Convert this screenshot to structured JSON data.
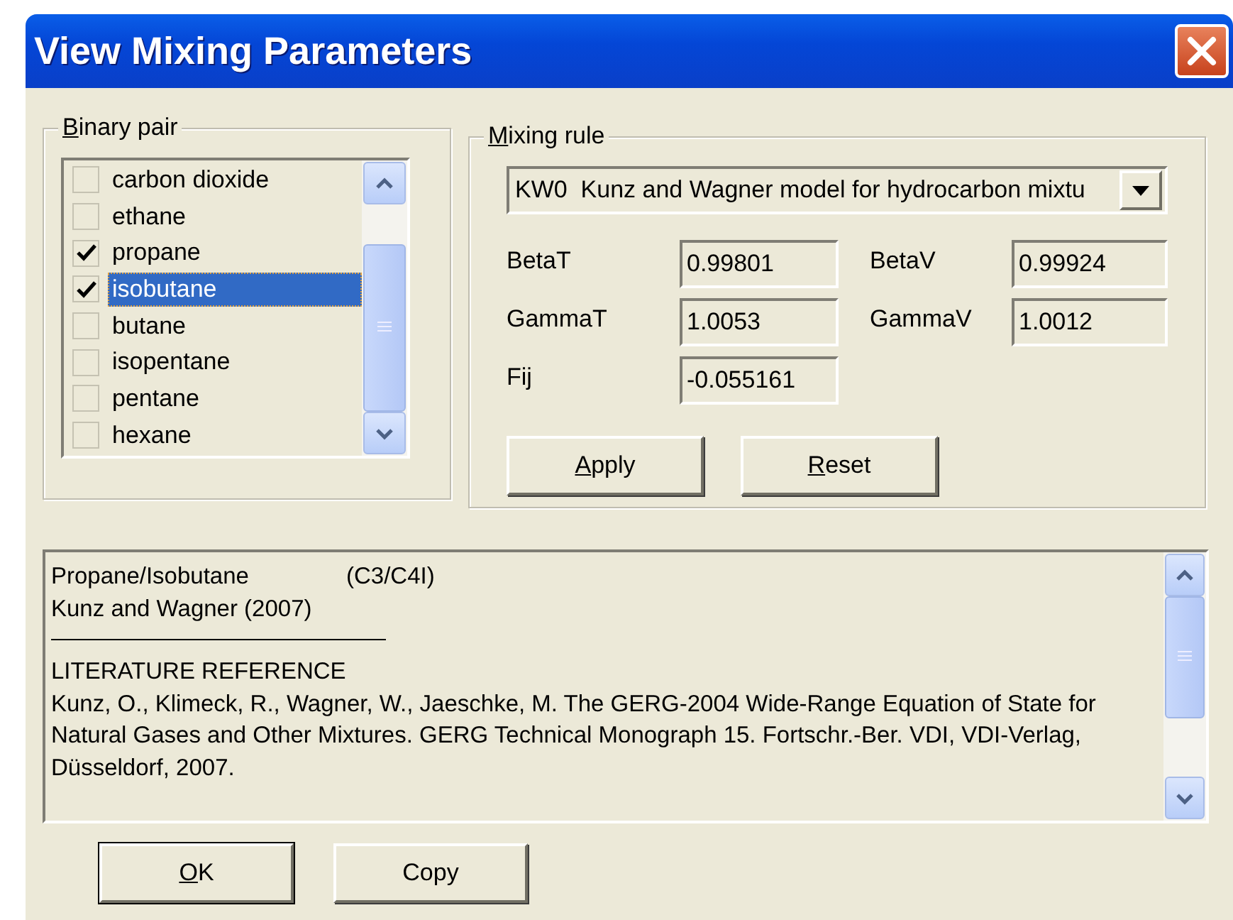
{
  "window": {
    "title": "View Mixing Parameters"
  },
  "binary_pair": {
    "label": "Binary pair",
    "underline_first": true,
    "items": [
      {
        "label": "carbon dioxide",
        "checked": false,
        "selected": false
      },
      {
        "label": "ethane",
        "checked": false,
        "selected": false
      },
      {
        "label": "propane",
        "checked": true,
        "selected": false
      },
      {
        "label": "isobutane",
        "checked": true,
        "selected": true
      },
      {
        "label": "butane",
        "checked": false,
        "selected": false
      },
      {
        "label": "isopentane",
        "checked": false,
        "selected": false
      },
      {
        "label": "pentane",
        "checked": false,
        "selected": false
      },
      {
        "label": "hexane",
        "checked": false,
        "selected": false
      }
    ]
  },
  "mixing_rule": {
    "label": "Mixing rule",
    "underline_first": true,
    "value": "KW0  Kunz and Wagner model for hydrocarbon mixtu",
    "parameters": [
      {
        "label": "BetaT",
        "value": "0.99801"
      },
      {
        "label": "BetaV",
        "value": "0.99924"
      },
      {
        "label": "GammaT",
        "value": "1.0053"
      },
      {
        "label": "GammaV",
        "value": "1.0012"
      },
      {
        "label": "Fij",
        "value": "-0.055161"
      }
    ],
    "buttons": [
      {
        "label": "Apply",
        "underline_first": true
      },
      {
        "label": "Reset",
        "underline_first": true
      }
    ]
  },
  "memo": {
    "title": "Propane/Isobutane",
    "formula": "(C3/C4I)",
    "source": "Kunz and Wagner (2007)",
    "heading": "LITERATURE REFERENCE",
    "reference": "Kunz, O., Klimeck, R., Wagner, W., Jaeschke, M. The GERG-2004 Wide-Range Equation of State for Natural Gases and Other Mixtures. GERG Technical Monograph 15. Fortschr.-Ber. VDI, VDI-Verlag, Düsseldorf, 2007."
  },
  "buttons": [
    {
      "label": "OK",
      "underline_first": true,
      "default": true
    },
    {
      "label": "Copy",
      "underline_first": false,
      "default": false
    }
  ]
}
